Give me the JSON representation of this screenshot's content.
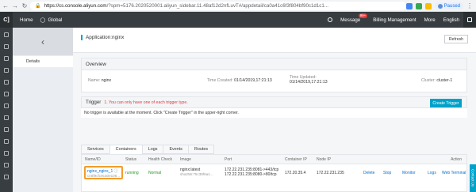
{
  "browser": {
    "url_host": "https://cs.console.aliyun.com",
    "url_rest": "/?spm=5176.2020520001.aliyun_sidebar.11.48af12d2nfLuvT#/appdetail/ca0a41c6f3f804bf90c1d1c1...",
    "paused_label": "Paused"
  },
  "topnav": {
    "logo": "C]",
    "home": "Home",
    "region": "Global",
    "message": "Message",
    "message_count": "99+",
    "billing": "Billing Management",
    "more": "More",
    "language": "English"
  },
  "subside": {
    "details": "Details"
  },
  "header": {
    "title": "Application:nginx",
    "refresh": "Refresh"
  },
  "overview": {
    "heading": "Overview",
    "name_label": "Name:",
    "name_value": "nginx",
    "created_label": "Time Created:",
    "created_value": "01/14/2019,17:21:13",
    "updated_label": "Time Updated:",
    "updated_value": "01/14/2019,17:21:13",
    "cluster_label": "Cluster:",
    "cluster_value": "cluster-1"
  },
  "trigger": {
    "heading": "Trigger",
    "warning": "1. You can only have one of each trigger type.",
    "create_button": "Create Trigger",
    "message": "No trigger is available at the moment. Click \"Create Trigger\" in the upper-right corner."
  },
  "tabs": [
    "Services",
    "Containers",
    "Logs",
    "Events",
    "Routes"
  ],
  "table": {
    "headers": [
      "Name/ID",
      "Status",
      "Health Check",
      "Image",
      "Port",
      "Container IP",
      "Node IP",
      "Action"
    ],
    "row": {
      "name": "nginx_nginx_1",
      "id": "cn6f9cfc9ca0e108...",
      "status": "running",
      "health": "Normal",
      "image": "nginx:latest",
      "image_hash": "sha256:75c38f6a1...",
      "port_1": "172.22.231.235:8081->443/tcp",
      "port_2": "172.22.231.235:8080->80/tcp",
      "container_ip": "172.20.35.4",
      "node_ip": "172.22.231.235",
      "actions": [
        "Delete",
        "Stop",
        "Monitor",
        "Logs",
        "Web Terminal"
      ]
    }
  },
  "feedback": "Contact Us"
}
